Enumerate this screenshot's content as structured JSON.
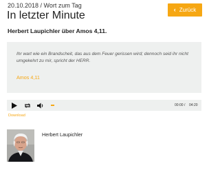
{
  "header": {
    "meta": "20.10.2018 / Wort zum Tag",
    "title": "In letzter Minute",
    "back_label": "Zurück"
  },
  "subtitle": "Herbert Laupichler über Amos 4,11.",
  "quote": {
    "text": "Ihr wart wie ein Brandscheit, das aus dem Feuer gerissen wird; dennoch seid ihr nicht umgekehrt zu mir, spricht der HERR.",
    "reference": "Amos 4,11"
  },
  "player": {
    "current_time": "00:00",
    "separator": "/",
    "total_time": "04:20",
    "volume_level": 0.05,
    "accent_color": "#f6a713"
  },
  "download_label": "Download",
  "author": {
    "name": "Herbert Laupichler"
  }
}
